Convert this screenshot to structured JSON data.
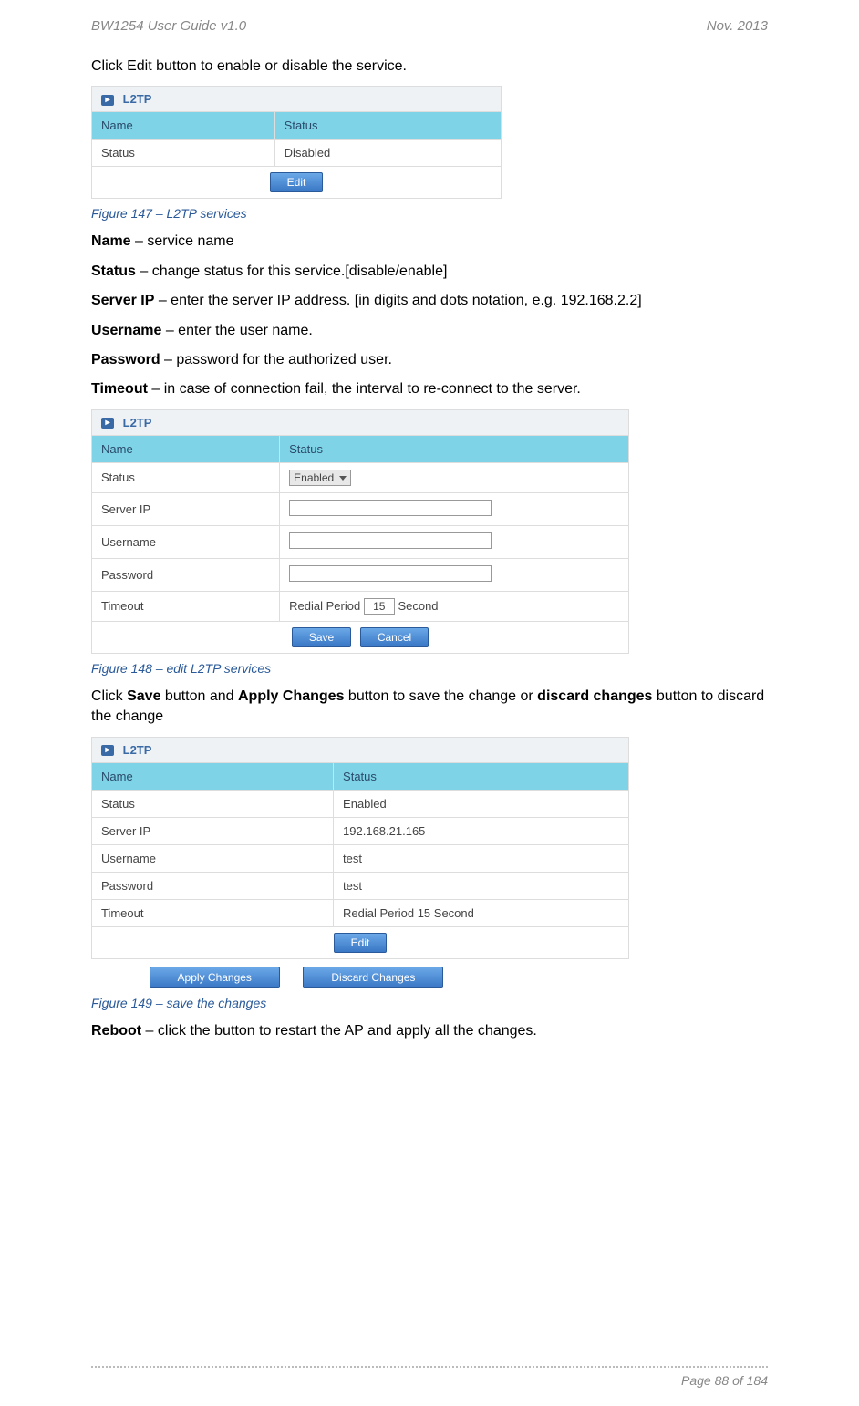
{
  "header": {
    "left": "BW1254 User Guide v1.0",
    "right": "Nov.  2013"
  },
  "intro_line": "Click Edit button to enable or disable the service.",
  "sec_title": "L2TP",
  "cols": {
    "name": "Name",
    "status": "Status"
  },
  "tbl1": {
    "row_name": "Status",
    "row_val": "Disabled",
    "edit_btn": "Edit"
  },
  "fig147": "Figure 147 – L2TP services",
  "defs": {
    "name_lbl": "Name",
    "name_txt": " – service name",
    "status_lbl": "Status",
    "status_txt": " – change status for this service.[disable/enable]",
    "serverip_lbl": "Server IP",
    "serverip_txt": " – enter the server IP address. [in digits and dots notation, e.g. 192.168.2.2]",
    "username_lbl": "Username",
    "username_txt": " – enter the user name.",
    "password_lbl": "Password",
    "password_txt": " – password for the authorized user.",
    "timeout_lbl": "Timeout",
    "timeout_txt": " – in case of connection fail, the interval to re-connect to the server."
  },
  "tbl2": {
    "rows": {
      "status": "Status",
      "status_sel": "Enabled",
      "serverip": "Server IP",
      "username": "Username",
      "password": "Password",
      "timeout": "Timeout",
      "redial_pre": "Redial Period",
      "redial_val": "15",
      "redial_post": "Second"
    },
    "save_btn": "Save",
    "cancel_btn": "Cancel"
  },
  "fig148": "Figure 148 – edit L2TP services",
  "save_paragraph": {
    "p1": "Click ",
    "b1": "Save",
    "p2": " button and ",
    "b2": "Apply Changes",
    "p3": " button to save the change or ",
    "b3": "discard changes",
    "p4": " button to discard the change"
  },
  "tbl3": {
    "rows": {
      "status_l": "Status",
      "status_v": "Enabled",
      "serverip_l": "Server IP",
      "serverip_v": "192.168.21.165",
      "username_l": "Username",
      "username_v": "test",
      "password_l": "Password",
      "password_v": "test",
      "timeout_l": "Timeout",
      "timeout_v": "Redial Period 15 Second"
    },
    "edit_btn": "Edit",
    "apply_btn": "Apply Changes",
    "discard_btn": "Discard Changes"
  },
  "fig149": "Figure 149 – save the changes",
  "reboot": {
    "lbl": "Reboot",
    "txt": " – click the button to restart the AP and apply all the changes."
  },
  "footer": "Page 88 of 184"
}
